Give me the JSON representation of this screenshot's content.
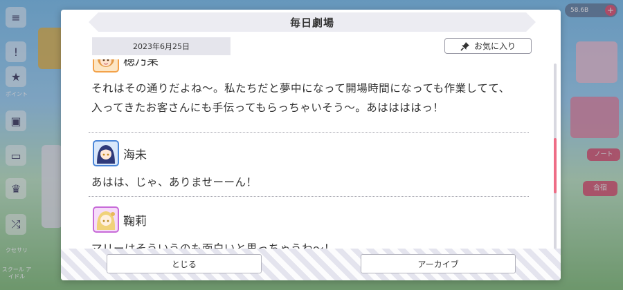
{
  "background": {
    "left_menu_labels": [
      "ポイント",
      "クセサリ",
      "スクール\nアイドル"
    ],
    "status_pill": "58.6B",
    "right_labels": [
      "ノート",
      "合宿"
    ]
  },
  "dialog": {
    "title": "毎日劇場",
    "date": "2023年6月25日",
    "favorite_label": "お気に入り",
    "entries": [
      {
        "speaker": "穂乃果",
        "lines": [
          "それはその通りだよね〜。私たちだと夢中になって開場時間になっても作業してて、",
          "入ってきたお客さんにも手伝ってもらっちゃいそう〜。あははははっ！"
        ]
      },
      {
        "speaker": "海未",
        "lines": [
          "あはは、じゃ、ありませーーん！"
        ]
      },
      {
        "speaker": "鞠莉",
        "lines": [
          "マリーはそういうのも面白いと思っちゃうわ〜！"
        ]
      }
    ],
    "close_label": "とじる",
    "archive_label": "アーカイブ"
  },
  "colors": {
    "scroll_thumb": "#ee6d86",
    "honoka_frame": "#f3a24a",
    "umi_frame": "#4a86d8",
    "mari_frame": "#c76ad8"
  }
}
